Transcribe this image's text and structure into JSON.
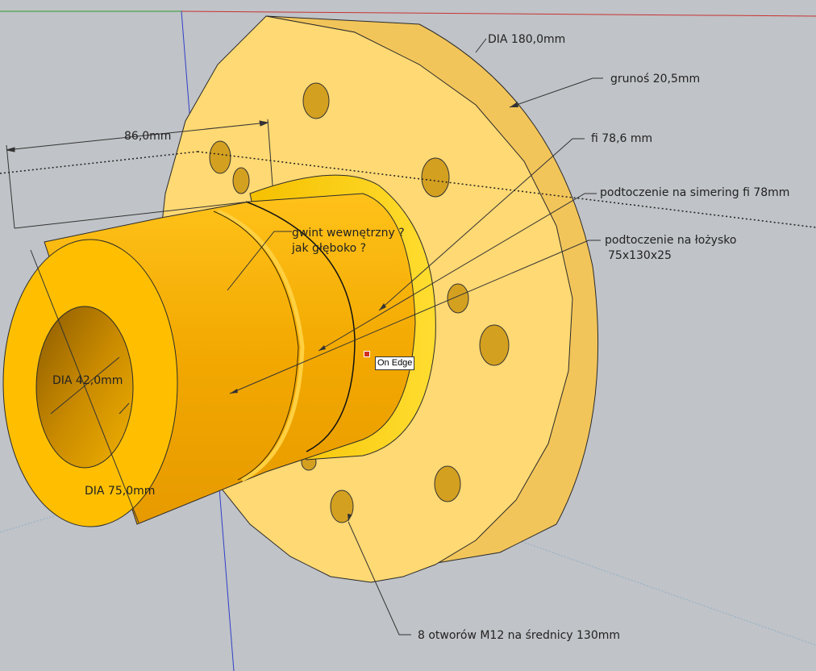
{
  "app": "SketchUp",
  "colors": {
    "background": "#c0c3c7",
    "flange_face": "#ffd973",
    "flange_rim": "#f2c55a",
    "shaft": "#f7b500",
    "axis_red": "#c83232",
    "axis_green": "#2e9b2e",
    "axis_blue": "#2f3fc8"
  },
  "annotations": {
    "dia_180": "DIA 180,0mm",
    "thickness": "grunoś 20,5mm",
    "fi_78_6": "fi 78,6 mm",
    "seal_groove": "podtoczenie na simering fi 78mm",
    "bearing_groove_l1": "podtoczenie na łożysko",
    "bearing_groove_l2": "75x130x25",
    "thread_l1": "gwint wewnętrzny ?",
    "thread_l2": "jak głęboko ?",
    "dim_86": "86,0mm",
    "dia_42": "DIA 42,0mm",
    "dia_75": "DIA 75,0mm",
    "holes": "8 otworów M12 na średnicy 130mm"
  },
  "tooltip": "On Edge"
}
